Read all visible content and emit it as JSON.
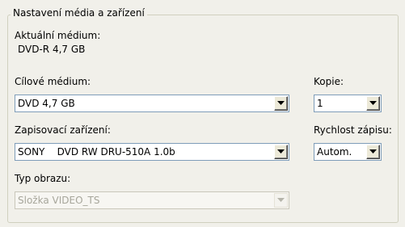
{
  "group": {
    "title": "Nastavení média a zařízení"
  },
  "current_medium": {
    "label": "Aktuální médium:",
    "value": "DVD-R  4,7 GB"
  },
  "target_medium": {
    "label": "Cílové médium:",
    "value": "DVD 4,7 GB"
  },
  "copies": {
    "label": "Kopie:",
    "value": "1"
  },
  "burner": {
    "label": "Zapisovací zařízení:",
    "value": "SONY    DVD RW DRU-510A 1.0b"
  },
  "write_speed": {
    "label": "Rychlost zápisu:",
    "value": "Autom."
  },
  "image_type": {
    "label": "Typ obrazu:",
    "value": "Složka VIDEO_TS"
  },
  "icons": {
    "dropdown": "chevron-down-icon"
  },
  "colors": {
    "border": "#7f9db9",
    "background": "#f1f0ea",
    "disabled_text": "#a7a69b"
  }
}
